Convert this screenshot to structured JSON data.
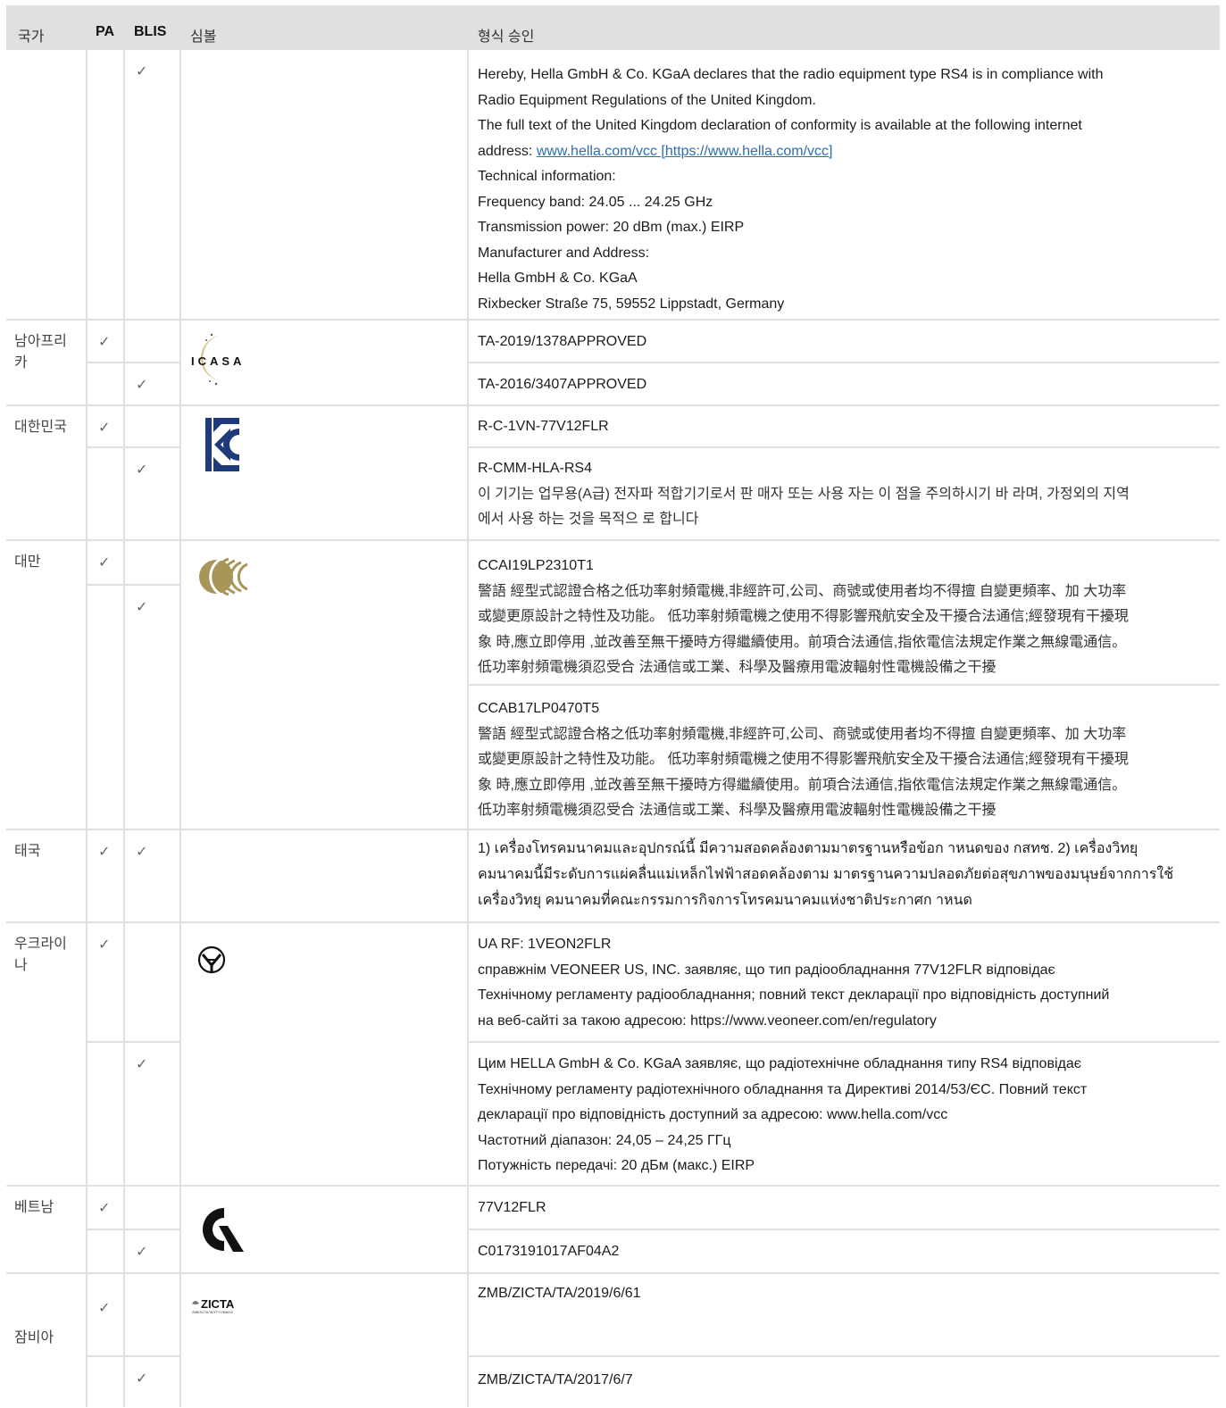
{
  "header": {
    "country": "국가",
    "pa": "PA",
    "blis": "BLIS",
    "symbol": "심볼",
    "approval": "형식 승인"
  },
  "check": "✓",
  "uk": {
    "lines": [
      "Hereby, Hella GmbH & Co. KGaA declares that the radio equipment type RS4 is in compliance with",
      "Radio Equipment Regulations of the United Kingdom.",
      "The full text of the United Kingdom declaration of conformity is available at the following internet"
    ],
    "address_prefix": "address: ",
    "link": "www.hella.com/vcc [https://www.hella.com/vcc]",
    "lines2": [
      "Technical information:",
      "Frequency band: 24.05 ... 24.25 GHz",
      "Transmission power: 20 dBm (max.) EIRP",
      "Manufacturer and Address:",
      "Hella GmbH & Co. KGaA",
      "Rixbecker Straße 75, 59552 Lippstadt, Germany"
    ]
  },
  "south_africa": {
    "country": "남아프리카",
    "logo_text": "ICASA",
    "pa": "TA-2019/1378APPROVED",
    "blis": "TA-2016/3407APPROVED"
  },
  "korea": {
    "country": "대한민국",
    "pa": "R-C-1VN-77V12FLR",
    "blis": "R-CMM-HLA-RS4",
    "notice": [
      "이 기기는 업무용(A급) 전자파 적합기기로서 판 매자 또는 사용 자는 이 점을 주의하시기 바 라며, 가정외의 지역",
      "에서 사용 하는 것을 목적으 로 합니다"
    ]
  },
  "taiwan": {
    "country": "대만",
    "pa": "CCAI19LP2310T1",
    "blis": "CCAB17LP0470T5",
    "notice": [
      "警語 經型式認證合格之低功率射頻電機,非經許可,公司、商號或使用者均不得擅 自變更頻率、加 大功率",
      "或變更原設計之特性及功能。 低功率射頻電機之使用不得影響飛航安全及干擾合法通信;經發現有干擾現",
      "象 時,應立即停用 ,並改善至無干擾時方得繼續使用。前項合法通信,指依電信法規定作業之無線電通信。",
      "低功率射頻電機須忍受合 法通信或工業、科學及醫療用電波輻射性電機設備之干擾"
    ]
  },
  "thailand": {
    "country": "태국",
    "lines": [
      "1) เครื่องโทรคมนาคมและอุปกรณ์นี้ มีความสอดคล้องตามมาตรฐานหรือข้อก าหนดของ กสทช. 2) เครื่องวิทยุ",
      "คมนาคมนี้มีระดับการแผ่คลื่นแม่เหล็กไฟฟ้าสอดคล้องตาม มาตรฐานความปลอดภัยต่อสุขภาพของมนุษย์จากการใช้",
      "เครื่องวิทยุ คมนาคมที่คณะกรรมการกิจการโทรคมนาคมแห่งชาติประกาศก าหนด"
    ]
  },
  "ukraine": {
    "country": "우크라이나",
    "pa": [
      "UA RF: 1VEON2FLR",
      "справжнім VEONEER US, INC. заявляє, що тип радіообладнання 77V12FLR відповідає",
      "Технічному регламенту радіообладнання; повний текст декларації про відповідність доступний",
      "на веб-сайті за такою адресою: https://www.veoneer.com/en/regulatory"
    ],
    "blis": [
      "Цим HELLA GmbH & Co. KGaA заявляє, що радіотехнічне обладнання типу RS4 відповідає",
      "Технічному регламенту радіотехнічного обладнання та Директиві 2014/53/ЄС. Повний текст",
      "декларації про відповідність доступний за адресою: www.hella.com/vcc",
      "Частотний діапазон: 24,05 – 24,25 ГГц",
      "Потужність передачі: 20 дБм (макс.) EIRP"
    ]
  },
  "vietnam": {
    "country": "베트남",
    "pa": "77V12FLR",
    "blis": "C0173191017AF04A2"
  },
  "zambia": {
    "country": "잠비아",
    "logo_text": "ZICTA",
    "logo_sub": "ZMB/ZICTA/TA/YYYY/MM/XX",
    "pa": "ZMB/ZICTA/TA/2019/6/61",
    "blis": "ZMB/ZICTA/TA/2017/6/7"
  },
  "colors": {
    "header_bg": "#e0e0e0",
    "border": "#e0e0e0",
    "link": "#2a6fb5",
    "kc": "#1f3a7a",
    "ncc": "#a89658"
  }
}
